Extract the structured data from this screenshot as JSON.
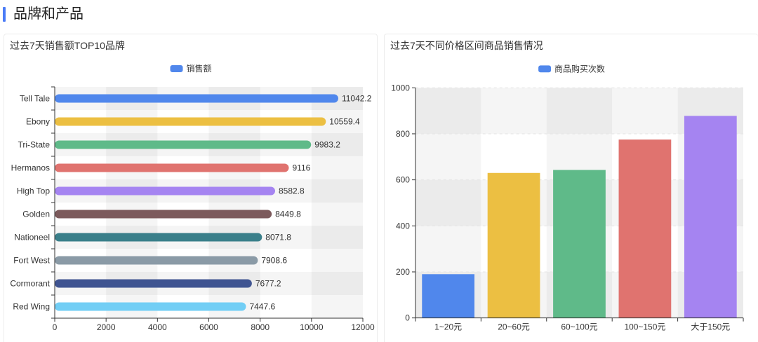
{
  "section": {
    "title": "品牌和产品",
    "accent_color": "#4A7BF7"
  },
  "chart_data": [
    {
      "type": "bar",
      "orientation": "horizontal",
      "title": "过去7天销售额TOP10品牌",
      "categories": [
        "Tell Tale",
        "Ebony",
        "Tri-State",
        "Hermanos",
        "High Top",
        "Golden",
        "Nationeel",
        "Fort West",
        "Cormorant",
        "Red Wing"
      ],
      "series": [
        {
          "name": "销售额",
          "values": [
            11042.2,
            10559.4,
            9983.2,
            9116,
            8582.8,
            8449.8,
            8071.8,
            7908.6,
            7677.2,
            7447.6
          ]
        }
      ],
      "colors": [
        "#5087EC",
        "#ECBF42",
        "#5FBA89",
        "#E0736F",
        "#A584F1",
        "#7C5A5C",
        "#3A7F8A",
        "#8A9AA6",
        "#3F5491",
        "#72CEF5"
      ],
      "legend_color": "#5087EC",
      "legend_position": "top-center",
      "data_labels": true,
      "xlim": [
        0,
        12000
      ],
      "xticks": [
        0,
        2000,
        4000,
        6000,
        8000,
        10000,
        12000
      ]
    },
    {
      "type": "bar",
      "orientation": "vertical",
      "title": "过去7天不同价格区间商品销售情况",
      "categories": [
        "1~20元",
        "20~60元",
        "60~100元",
        "100~150元",
        "大于150元"
      ],
      "series": [
        {
          "name": "商品购买次数",
          "values": [
            190,
            630,
            643,
            775,
            878
          ]
        }
      ],
      "colors": [
        "#5087EC",
        "#ECBF42",
        "#5FBA89",
        "#E0736F",
        "#A584F1"
      ],
      "legend_color": "#5087EC",
      "legend_position": "top-center",
      "data_labels": false,
      "ylim": [
        0,
        1000
      ],
      "yticks": [
        0,
        200,
        400,
        600,
        800,
        1000
      ]
    }
  ]
}
